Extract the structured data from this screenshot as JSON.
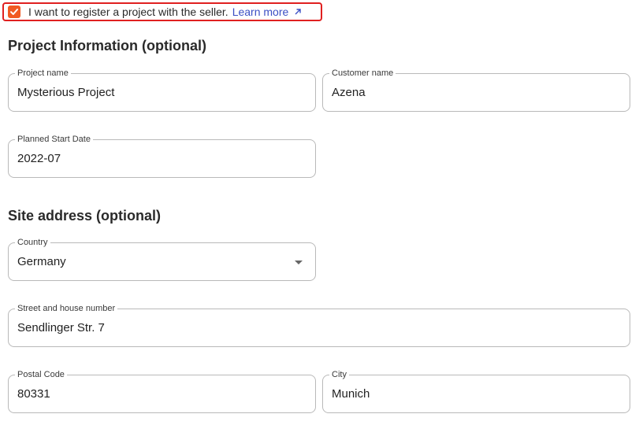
{
  "consent": {
    "checked": true,
    "label": "I want to register a project with the seller.",
    "link_text": "Learn more",
    "accent_color": "#f15a22",
    "highlight_color": "#e02020"
  },
  "project_section": {
    "title": "Project Information (optional)",
    "project_name": {
      "label": "Project name",
      "value": "Mysterious Project"
    },
    "customer_name": {
      "label": "Customer name",
      "value": "Azena"
    },
    "planned_start": {
      "label": "Planned Start Date",
      "value": "2022-07"
    }
  },
  "site_section": {
    "title": "Site address (optional)",
    "country": {
      "label": "Country",
      "value": "Germany"
    },
    "street": {
      "label": "Street and house number",
      "value": "Sendlinger Str. 7"
    },
    "postal_code": {
      "label": "Postal Code",
      "value": "80331"
    },
    "city": {
      "label": "City",
      "value": "Munich"
    }
  }
}
